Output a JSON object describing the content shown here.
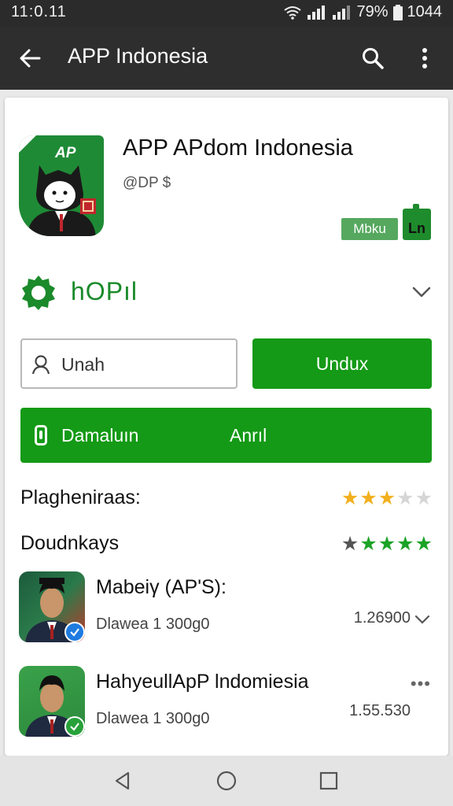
{
  "status_bar": {
    "time": "11:0.11",
    "battery_text": "79%",
    "clock_right": "1044",
    "icons": [
      "wifi-icon",
      "signal-icon",
      "signal-icon",
      "battery-icon"
    ]
  },
  "app_bar": {
    "title": "APP Indonesia",
    "icons": [
      "back-arrow-icon",
      "search-icon",
      "more-vert-icon"
    ]
  },
  "app": {
    "icon_text": "AP",
    "title": "APP APdom Indonesia",
    "subtitle": "@DP $",
    "badge_1": "Mbku",
    "badge_2": "Ln"
  },
  "section": {
    "icon": "gear-icon",
    "label": "hOPıl"
  },
  "search": {
    "value": "Unah",
    "icon": "user-icon"
  },
  "buttons": {
    "undux": "Undux",
    "big_left": "Damaluın",
    "big_right": "Anrıl"
  },
  "ratings": [
    {
      "label": "Plagheniraas:",
      "stars_value": 3,
      "stars_max": 5,
      "star_color": "#f2b01e"
    },
    {
      "label": "Doudnkays",
      "stars_value": 5,
      "stars_max": 5,
      "star_color": "#1ba327"
    }
  ],
  "list": [
    {
      "title": "Mabeiγ (AP'S):",
      "subtitle": "Dlawea 1 300g0",
      "value": "1.26900",
      "action_icon": "chevron-down-icon",
      "verified_color": "#1e7be0"
    },
    {
      "title": "HahyeullApP lndomiesia",
      "subtitle": "Dlawea 1 300g0",
      "value": "1.55.530",
      "action_icon": "more-horiz-icon",
      "verified_color": "#27a23a"
    }
  ],
  "nav_bar": {
    "icons": [
      "back-triangle-icon",
      "home-circle-icon",
      "recents-square-icon"
    ]
  },
  "colors": {
    "primary_green": "#149a16",
    "app_bar": "#2e2e2e",
    "status_bar": "#2b2b2b"
  }
}
